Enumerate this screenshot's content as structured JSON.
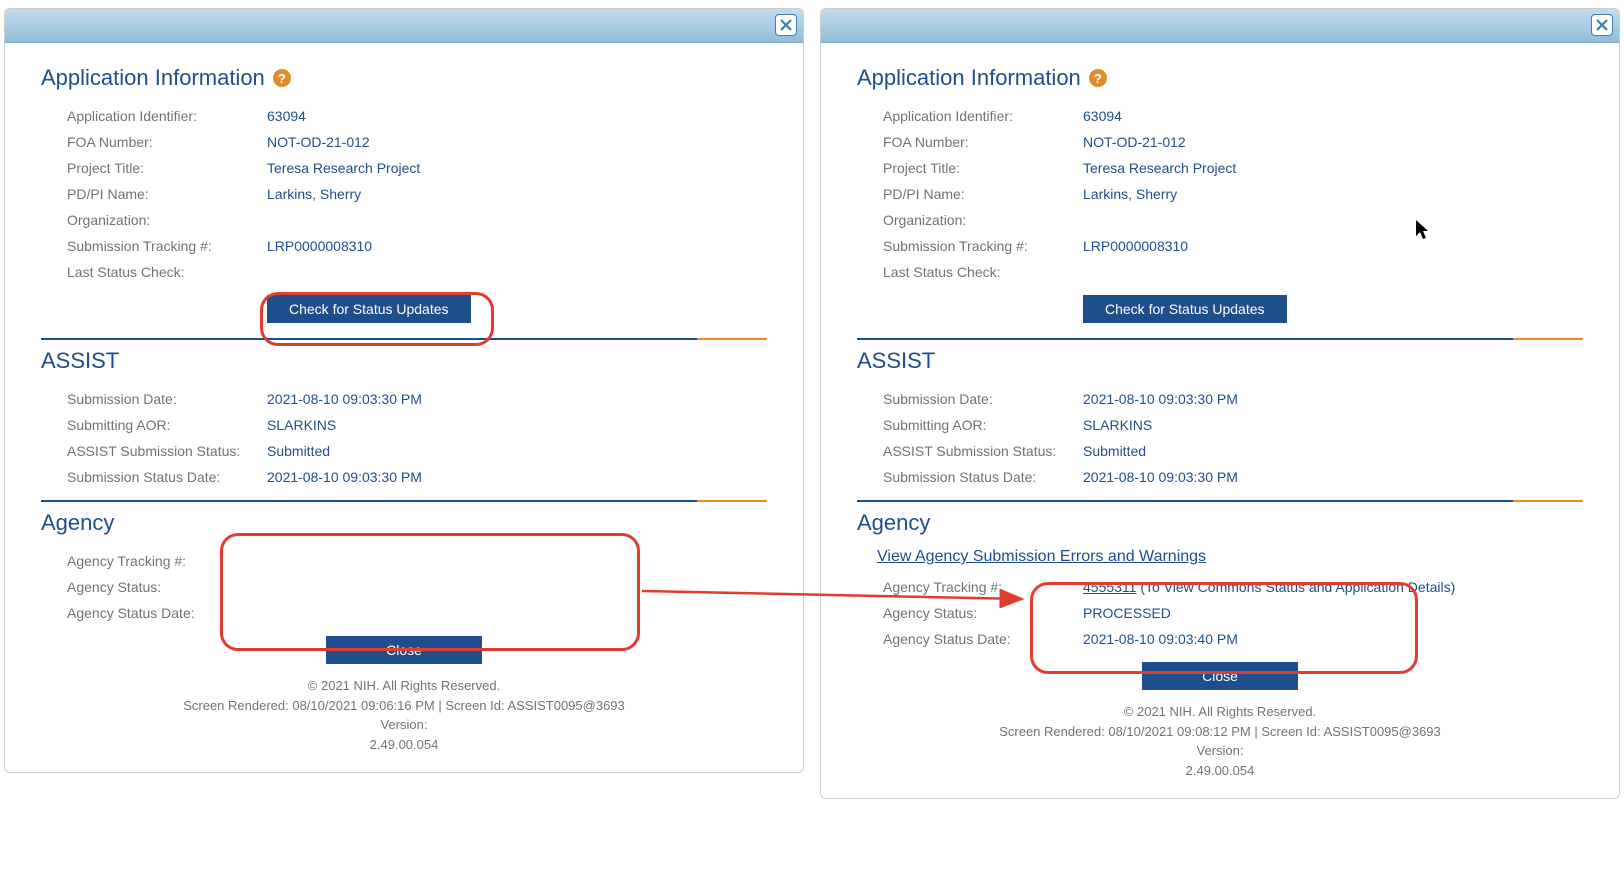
{
  "left": {
    "heading": "Application Information",
    "appInfo": {
      "labels": {
        "appId": "Application Identifier:",
        "foa": "FOA Number:",
        "title": "Project Title:",
        "pdpi": "PD/PI Name:",
        "org": "Organization:",
        "tracking": "Submission Tracking #:",
        "lastCheck": "Last Status Check:"
      },
      "values": {
        "appId": "63094",
        "foa": "NOT-OD-21-012",
        "title": "Teresa Research Project",
        "pdpi": "Larkins, Sherry",
        "org": "",
        "tracking": "LRP0000008310",
        "lastCheck": ""
      }
    },
    "checkStatusBtn": "Check for Status Updates",
    "assistHeading": "ASSIST",
    "assist": {
      "labels": {
        "subDate": "Submission Date:",
        "aor": "Submitting AOR:",
        "status": "ASSIST Submission Status:",
        "statusDate": "Submission Status Date:"
      },
      "values": {
        "subDate": "2021-08-10 09:03:30 PM",
        "aor": "SLARKINS",
        "status": "Submitted",
        "statusDate": "2021-08-10 09:03:30 PM"
      }
    },
    "agencyHeading": "Agency",
    "agency": {
      "labels": {
        "tracking": "Agency Tracking #:",
        "status": "Agency Status:",
        "statusDate": "Agency Status Date:"
      },
      "values": {
        "tracking": "",
        "status": "",
        "statusDate": ""
      }
    },
    "closeBtn": "Close",
    "footer": {
      "copyright": "© 2021 NIH. All Rights Reserved.",
      "rendered": "Screen Rendered: 08/10/2021 09:06:16 PM | Screen Id: ASSIST0095@3693",
      "versionLabel": "Version:",
      "version": "2.49.00.054"
    }
  },
  "right": {
    "heading": "Application Information",
    "appInfo": {
      "labels": {
        "appId": "Application Identifier:",
        "foa": "FOA Number:",
        "title": "Project Title:",
        "pdpi": "PD/PI Name:",
        "org": "Organization:",
        "tracking": "Submission Tracking #:",
        "lastCheck": "Last Status Check:"
      },
      "values": {
        "appId": "63094",
        "foa": "NOT-OD-21-012",
        "title": "Teresa Research Project",
        "pdpi": "Larkins, Sherry",
        "org": "",
        "tracking": "LRP0000008310",
        "lastCheck": ""
      }
    },
    "checkStatusBtn": "Check for Status Updates",
    "assistHeading": "ASSIST",
    "assist": {
      "labels": {
        "subDate": "Submission Date:",
        "aor": "Submitting AOR:",
        "status": "ASSIST Submission Status:",
        "statusDate": "Submission Status Date:"
      },
      "values": {
        "subDate": "2021-08-10 09:03:30 PM",
        "aor": "SLARKINS",
        "status": "Submitted",
        "statusDate": "2021-08-10 09:03:30 PM"
      }
    },
    "agencyHeading": "Agency",
    "viewErrorsLink": "View Agency Submission Errors and Warnings",
    "agency": {
      "labels": {
        "tracking": "Agency Tracking #:",
        "status": "Agency Status:",
        "statusDate": "Agency Status Date:"
      },
      "values": {
        "trackingLink": "4555311",
        "trackingSuffix": " (To View Commons Status and Application Details)",
        "status": "PROCESSED",
        "statusDate": "2021-08-10 09:03:40 PM"
      }
    },
    "closeBtn": "Close",
    "footer": {
      "copyright": "© 2021 NIH. All Rights Reserved.",
      "rendered": "Screen Rendered: 08/10/2021 09:08:12 PM | Screen Id: ASSIST0095@3693",
      "versionLabel": "Version:",
      "version": "2.49.00.054"
    }
  }
}
